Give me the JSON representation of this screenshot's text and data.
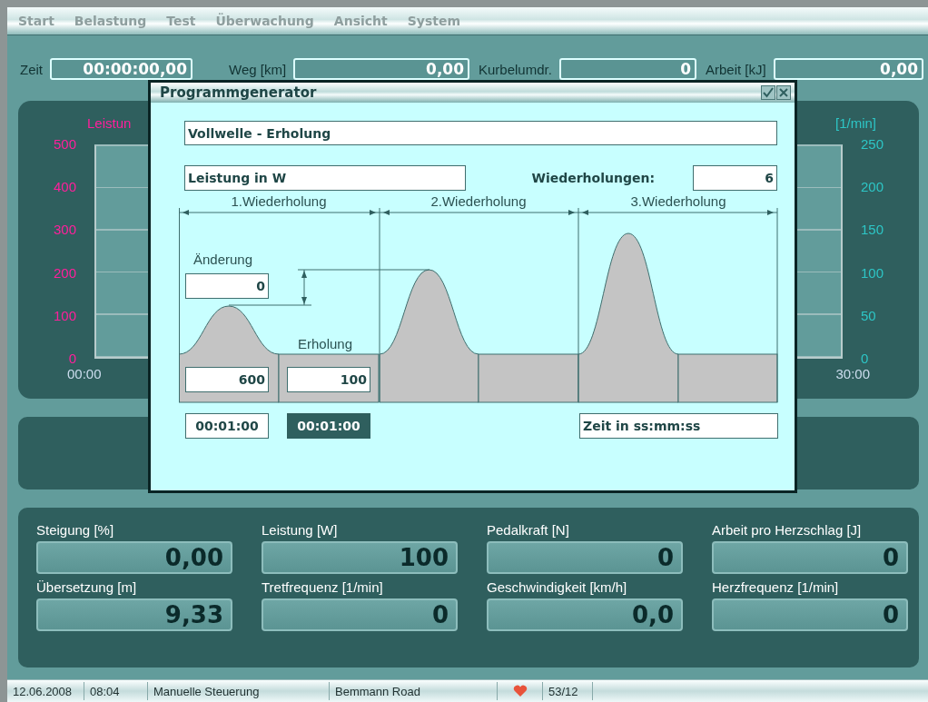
{
  "menu": [
    {
      "label": "Start"
    },
    {
      "label": "Belastung"
    },
    {
      "label": "Test"
    },
    {
      "label": "Überwachung"
    },
    {
      "label": "Ansicht"
    },
    {
      "label": "System"
    }
  ],
  "top_readouts": [
    {
      "label": "Zeit",
      "value": "00:00:00,00"
    },
    {
      "label": "Weg [km]",
      "value": "0,00"
    },
    {
      "label": "Kurbelumdr.",
      "value": "0"
    },
    {
      "label": "Arbeit [kJ]",
      "value": "0,00"
    }
  ],
  "chart": {
    "left_title": "Leistun",
    "left_ticks": [
      "500",
      "400",
      "300",
      "200",
      "100",
      "0"
    ],
    "left_time": "00:00",
    "right_title": "[1/min]",
    "right_ticks": [
      "250",
      "200",
      "150",
      "100",
      "50",
      "0"
    ],
    "right_time": "30:00"
  },
  "dialog": {
    "title": "Programmgenerator",
    "program_name": "Vollwelle - Erholung",
    "unit": "Leistung in W",
    "repeats_label": "Wiederholungen:",
    "repeats_value": "6",
    "segments": [
      {
        "label": "1.Wiederholung"
      },
      {
        "label": "2.Wiederholung"
      },
      {
        "label": "3.Wiederholung"
      }
    ],
    "change_label": "Änderung",
    "change_value": "0",
    "recovery_label": "Erholung",
    "load_value": "600",
    "recovery_value": "100",
    "times": [
      {
        "value": "00:01:00",
        "selected": false
      },
      {
        "value": "00:01:00",
        "selected": true
      }
    ],
    "time_format": "Zeit in ss:mm:ss"
  },
  "measurements": [
    {
      "label": "Steigung [%]",
      "value": "0,00"
    },
    {
      "label": "Leistung [W]",
      "value": "100"
    },
    {
      "label": "Pedalkraft [N]",
      "value": "0"
    },
    {
      "label": "Arbeit pro Herzschlag [J]",
      "value": "0"
    },
    {
      "label": "Übersetzung [m]",
      "value": "9,33"
    },
    {
      "label": "Tretfrequenz [1/min]",
      "value": "0"
    },
    {
      "label": "Geschwindigkeit [km/h]",
      "value": "0,0"
    },
    {
      "label": "Herzfrequenz [1/min]",
      "value": "0"
    }
  ],
  "status_bar": [
    {
      "kind": "text",
      "text": "12.06.2008"
    },
    {
      "kind": "text",
      "text": "08:04"
    },
    {
      "kind": "text",
      "text": "Manuelle Steuerung"
    },
    {
      "kind": "text",
      "text": "Bemmann Road"
    },
    {
      "kind": "heart"
    },
    {
      "kind": "text",
      "text": "53/12"
    }
  ]
}
